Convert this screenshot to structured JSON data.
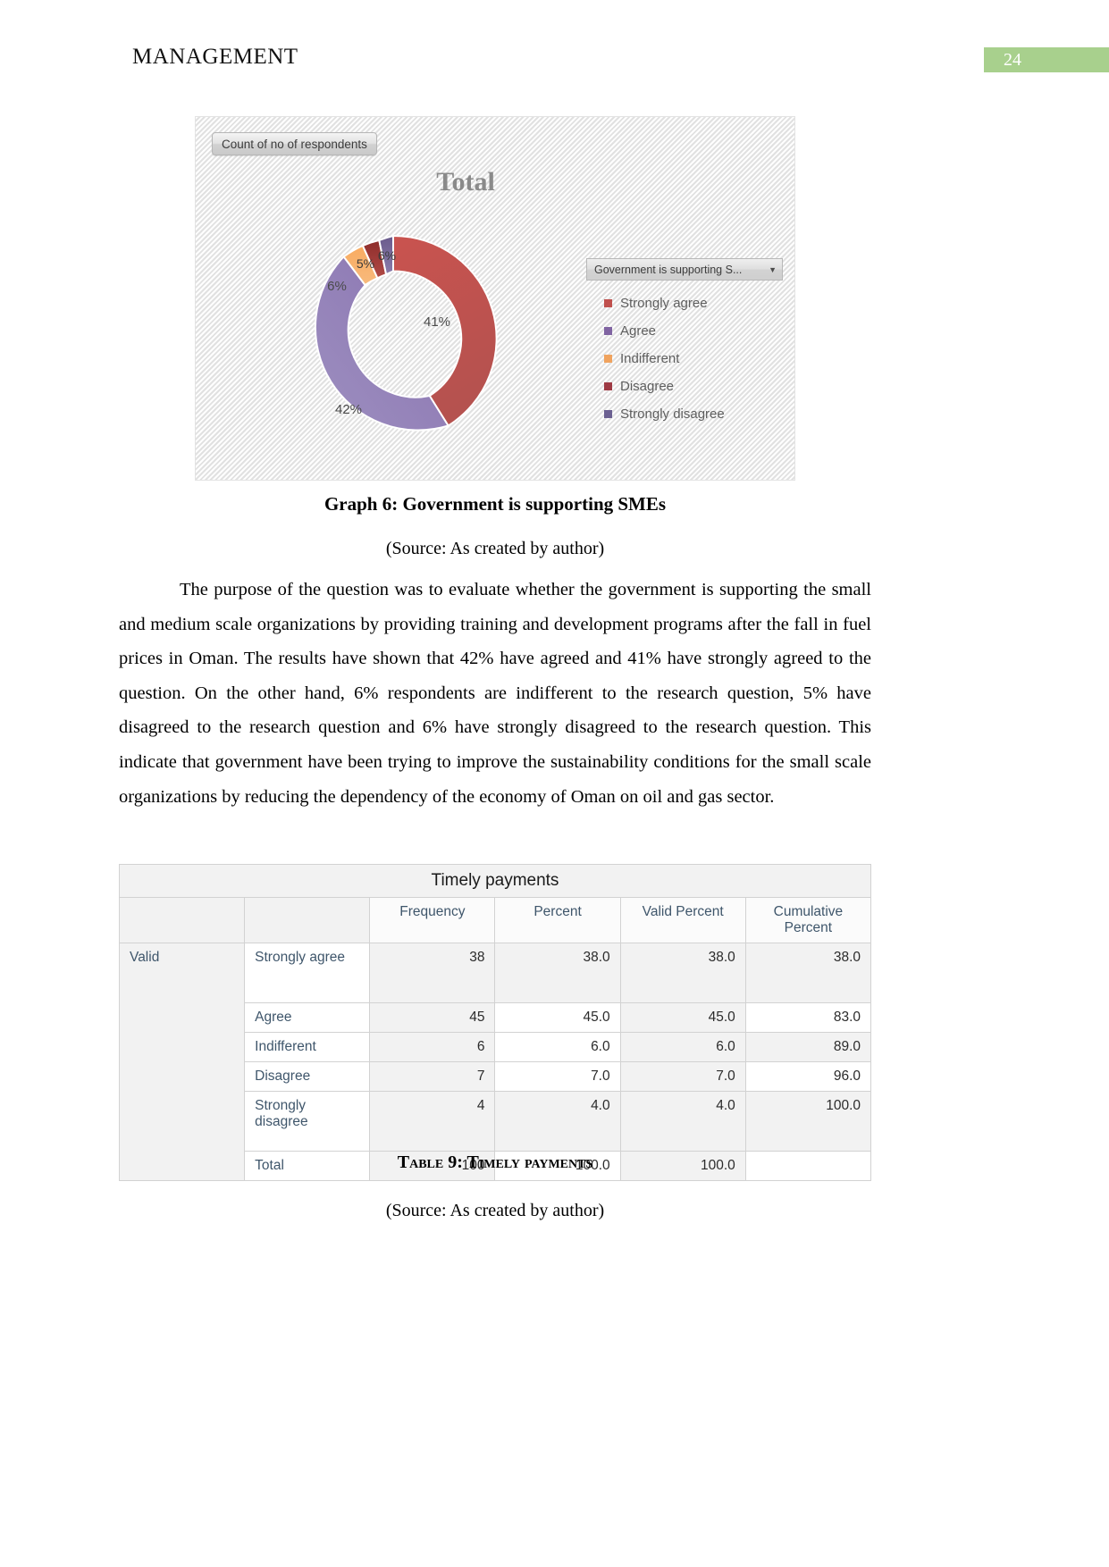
{
  "header": {
    "title": "MANAGEMENT",
    "page_number": "24",
    "badge_color": "#a8d08d"
  },
  "chart_block": {
    "field_button_label": "Count of no of respondents",
    "legend_filter_label": "Government is supporting  S...",
    "legend_filter_caret": "▼",
    "caption": "Graph 6: Government is supporting SMEs",
    "source": "(Source: As created by author)"
  },
  "chart_data": {
    "type": "pie",
    "title": "Total",
    "subtitle": "Count of no of respondents",
    "donut": true,
    "legend_title": "Government is supporting  S...",
    "legend_position": "right",
    "categories": [
      "Strongly agree",
      "Agree",
      "Indifferent",
      "Disagree",
      "Strongly disagree"
    ],
    "values": [
      41,
      42,
      6,
      5,
      6
    ],
    "data_labels": [
      "41%",
      "42%",
      "6%",
      "5%",
      "6%"
    ],
    "colors": [
      "#c0504d",
      "#8064a2",
      "#f79646",
      "#9e3a38",
      "#6b5a8e"
    ],
    "start_angle_deg": 0,
    "xlabel": "",
    "ylabel": ""
  },
  "body": {
    "paragraph": "The purpose of the question was to evaluate whether the government is supporting the small and medium scale organizations by providing training and development programs after the fall in fuel prices in Oman. The results have shown that 42% have agreed and 41% have strongly agreed to the question. On the other hand, 6% respondents are indifferent to the research question, 5% have disagreed to the research question and 6% have strongly disagreed to the research question. This indicate that government have been trying to improve the sustainability conditions for the small scale organizations by reducing the dependency of the economy of Oman on oil and gas sector."
  },
  "table": {
    "title": "Timely payments",
    "columns": [
      "Frequency",
      "Percent",
      "Valid Percent",
      "Cumulative Percent"
    ],
    "group_label": "Valid",
    "rows": [
      {
        "label": "Strongly agree",
        "frequency": "38",
        "percent": "38.0",
        "valid_percent": "38.0",
        "cumulative_percent": "38.0"
      },
      {
        "label": "Agree",
        "frequency": "45",
        "percent": "45.0",
        "valid_percent": "45.0",
        "cumulative_percent": "83.0"
      },
      {
        "label": "Indifferent",
        "frequency": "6",
        "percent": "6.0",
        "valid_percent": "6.0",
        "cumulative_percent": "89.0"
      },
      {
        "label": "Disagree",
        "frequency": "7",
        "percent": "7.0",
        "valid_percent": "7.0",
        "cumulative_percent": "96.0"
      },
      {
        "label": "Strongly disagree",
        "frequency": "4",
        "percent": "4.0",
        "valid_percent": "4.0",
        "cumulative_percent": "100.0"
      },
      {
        "label": "Total",
        "frequency": "100",
        "percent": "100.0",
        "valid_percent": "100.0",
        "cumulative_percent": ""
      }
    ],
    "caption": "Table 9: Timely payments",
    "source": "(Source: As created by author)"
  }
}
